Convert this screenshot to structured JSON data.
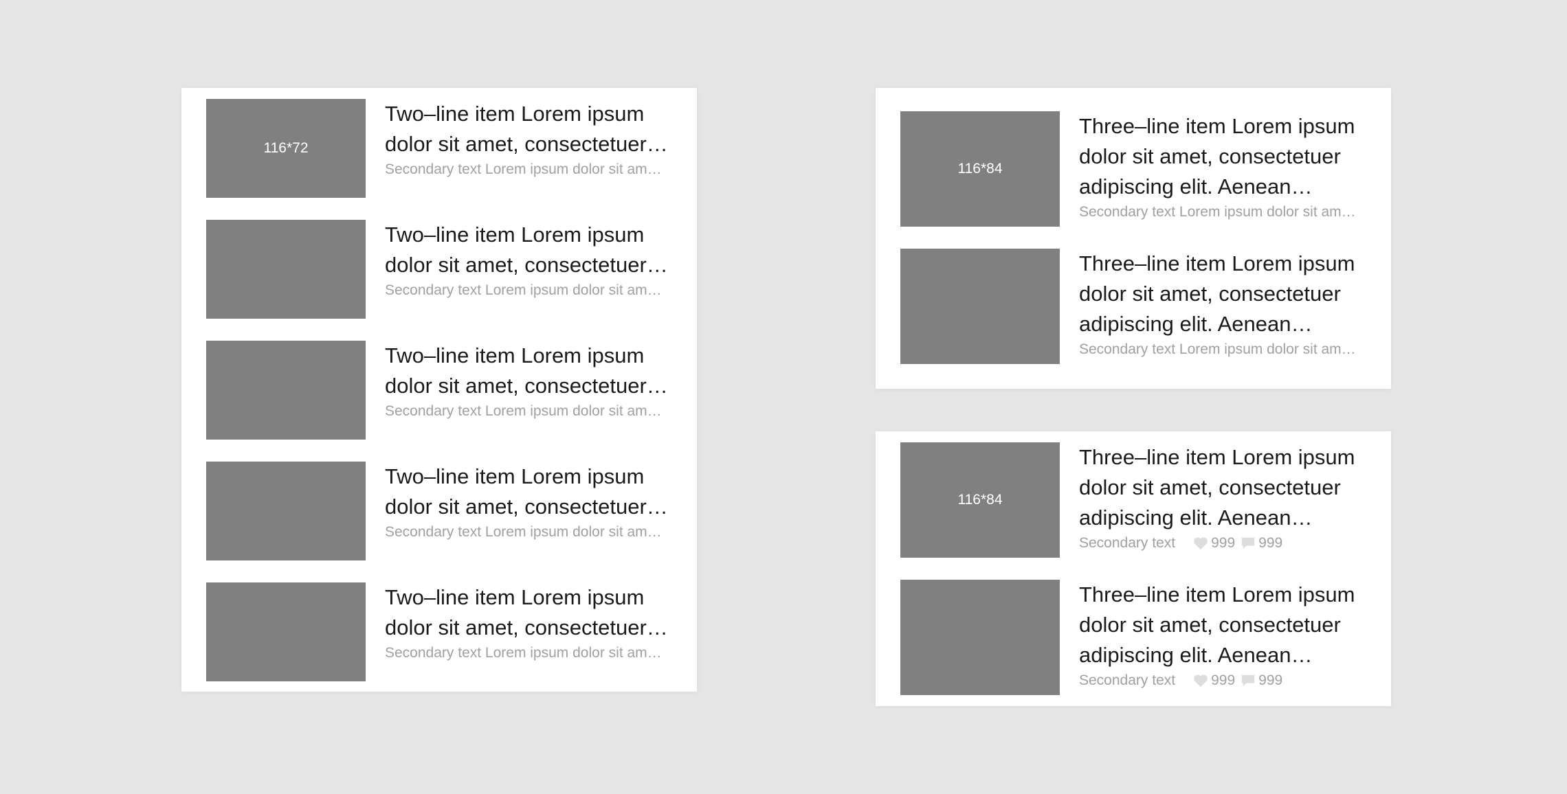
{
  "left_list": {
    "items": [
      {
        "thumb_label": "116*72",
        "title": "Two–line item Lorem ipsum dolor sit amet, consectetuer adipiscing elit.",
        "secondary": "Secondary text Lorem ipsum dolor sit amet, consectetuer"
      },
      {
        "thumb_label": "",
        "title": "Two–line item Lorem ipsum dolor sit amet, consectetuer adipiscing elit.",
        "secondary": "Secondary text Lorem ipsum dolor sit amet, consectetuer"
      },
      {
        "thumb_label": "",
        "title": "Two–line item Lorem ipsum dolor sit amet, consectetuer adipiscing elit.",
        "secondary": "Secondary text Lorem ipsum dolor sit amet, consectetuer"
      },
      {
        "thumb_label": "",
        "title": "Two–line item Lorem ipsum dolor sit amet, consectetuer adipiscing elit.",
        "secondary": "Secondary text Lorem ipsum dolor sit amet, consectetuer"
      },
      {
        "thumb_label": "",
        "title": "Two–line item Lorem ipsum dolor sit amet, consectetuer adipiscing elit.",
        "secondary": "Secondary text Lorem ipsum dolor sit amet, consectetuer"
      }
    ]
  },
  "top_right_list": {
    "items": [
      {
        "thumb_label": "116*84",
        "title": "Three–line item Lorem ipsum dolor sit amet, consectetuer adipiscing elit. Aenean commodo ligula eget dolor.",
        "secondary": "Secondary text Lorem ipsum dolor sit amet, consectetuer"
      },
      {
        "thumb_label": "",
        "title": "Three–line item Lorem ipsum dolor sit amet, consectetuer adipiscing elit. Aenean commodo ligula eget dolor.",
        "secondary": "Secondary text Lorem ipsum dolor sit amet, consectetuer"
      }
    ]
  },
  "bottom_right_list": {
    "items": [
      {
        "thumb_label": "116*84",
        "title": "Three–line item Lorem ipsum dolor sit amet, consectetuer adipiscing elit. Aenean commodo ligula eget dolor.",
        "secondary": "Secondary text",
        "likes": "999",
        "comments": "999"
      },
      {
        "thumb_label": "",
        "title": "Three–line item Lorem ipsum dolor sit amet, consectetuer adipiscing elit. Aenean commodo ligula eget dolor.",
        "secondary": "Secondary text",
        "likes": "999",
        "comments": "999"
      }
    ]
  },
  "icons": {
    "like": "heart-icon",
    "comment": "comment-icon"
  },
  "colors": {
    "background": "#e5e5e5",
    "card": "#ffffff",
    "thumbnail": "#808080",
    "title_text": "#1a1a1a",
    "secondary_text": "#a0a0a0",
    "meta_icon": "#dddddd"
  }
}
